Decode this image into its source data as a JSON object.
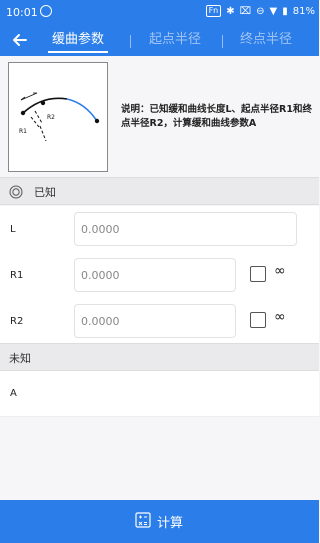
{
  "statusbar": {
    "time": "10:01",
    "fn": "Fn",
    "battery": "81%"
  },
  "tabs": [
    {
      "label": "缓曲参数",
      "active": true
    },
    {
      "label": "起点半径",
      "active": false
    },
    {
      "label": "终点半径",
      "active": false
    }
  ],
  "illustration": {
    "label_r1": "R1",
    "label_r2": "R2"
  },
  "description": "说明：已知缓和曲线长度L、起点半径R1和终点半径R2，计算缓和曲线参数A",
  "known": {
    "title": "已知",
    "rows": [
      {
        "label": "L",
        "value": "0.0000"
      },
      {
        "label": "R1",
        "value": "0.0000",
        "infinity": "∞"
      },
      {
        "label": "R2",
        "value": "0.0000",
        "infinity": "∞"
      }
    ]
  },
  "unknown": {
    "title": "未知",
    "rows": [
      {
        "label": "A",
        "value": ""
      }
    ]
  },
  "calculate_label": "计算",
  "colors": {
    "primary": "#2b7de9",
    "section_bg": "#eaeaec",
    "body_bg": "#f6f6f8"
  }
}
